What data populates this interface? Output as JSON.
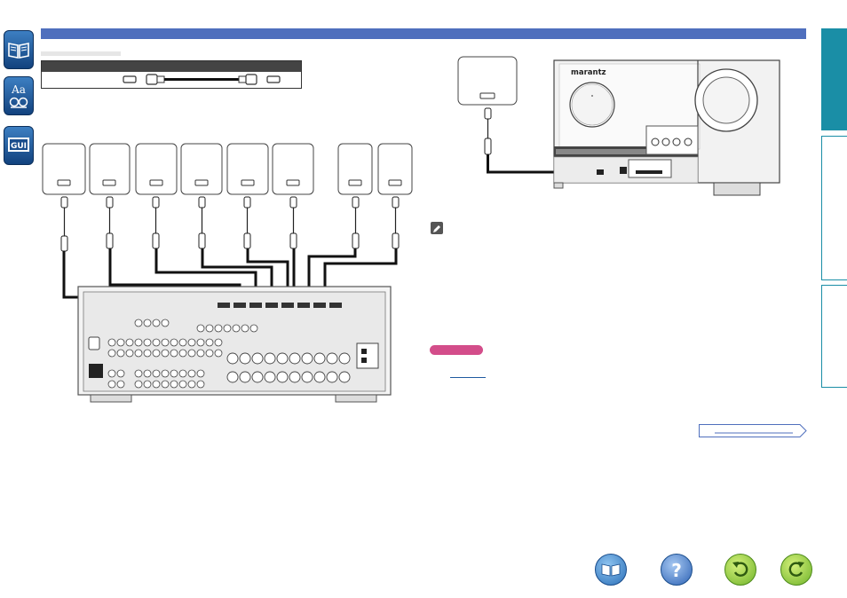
{
  "receiver": {
    "brand": "marantz"
  },
  "nav_buttons": [
    "manual-contents",
    "help",
    "back",
    "forward"
  ],
  "colors": {
    "header_bar": "#4f6fbd",
    "side_tab_active": "#1a8ea6",
    "side_tab_border": "#1a8ea6",
    "note_pill": "#d34d8a",
    "icon_blue": "#1f5aa0"
  }
}
